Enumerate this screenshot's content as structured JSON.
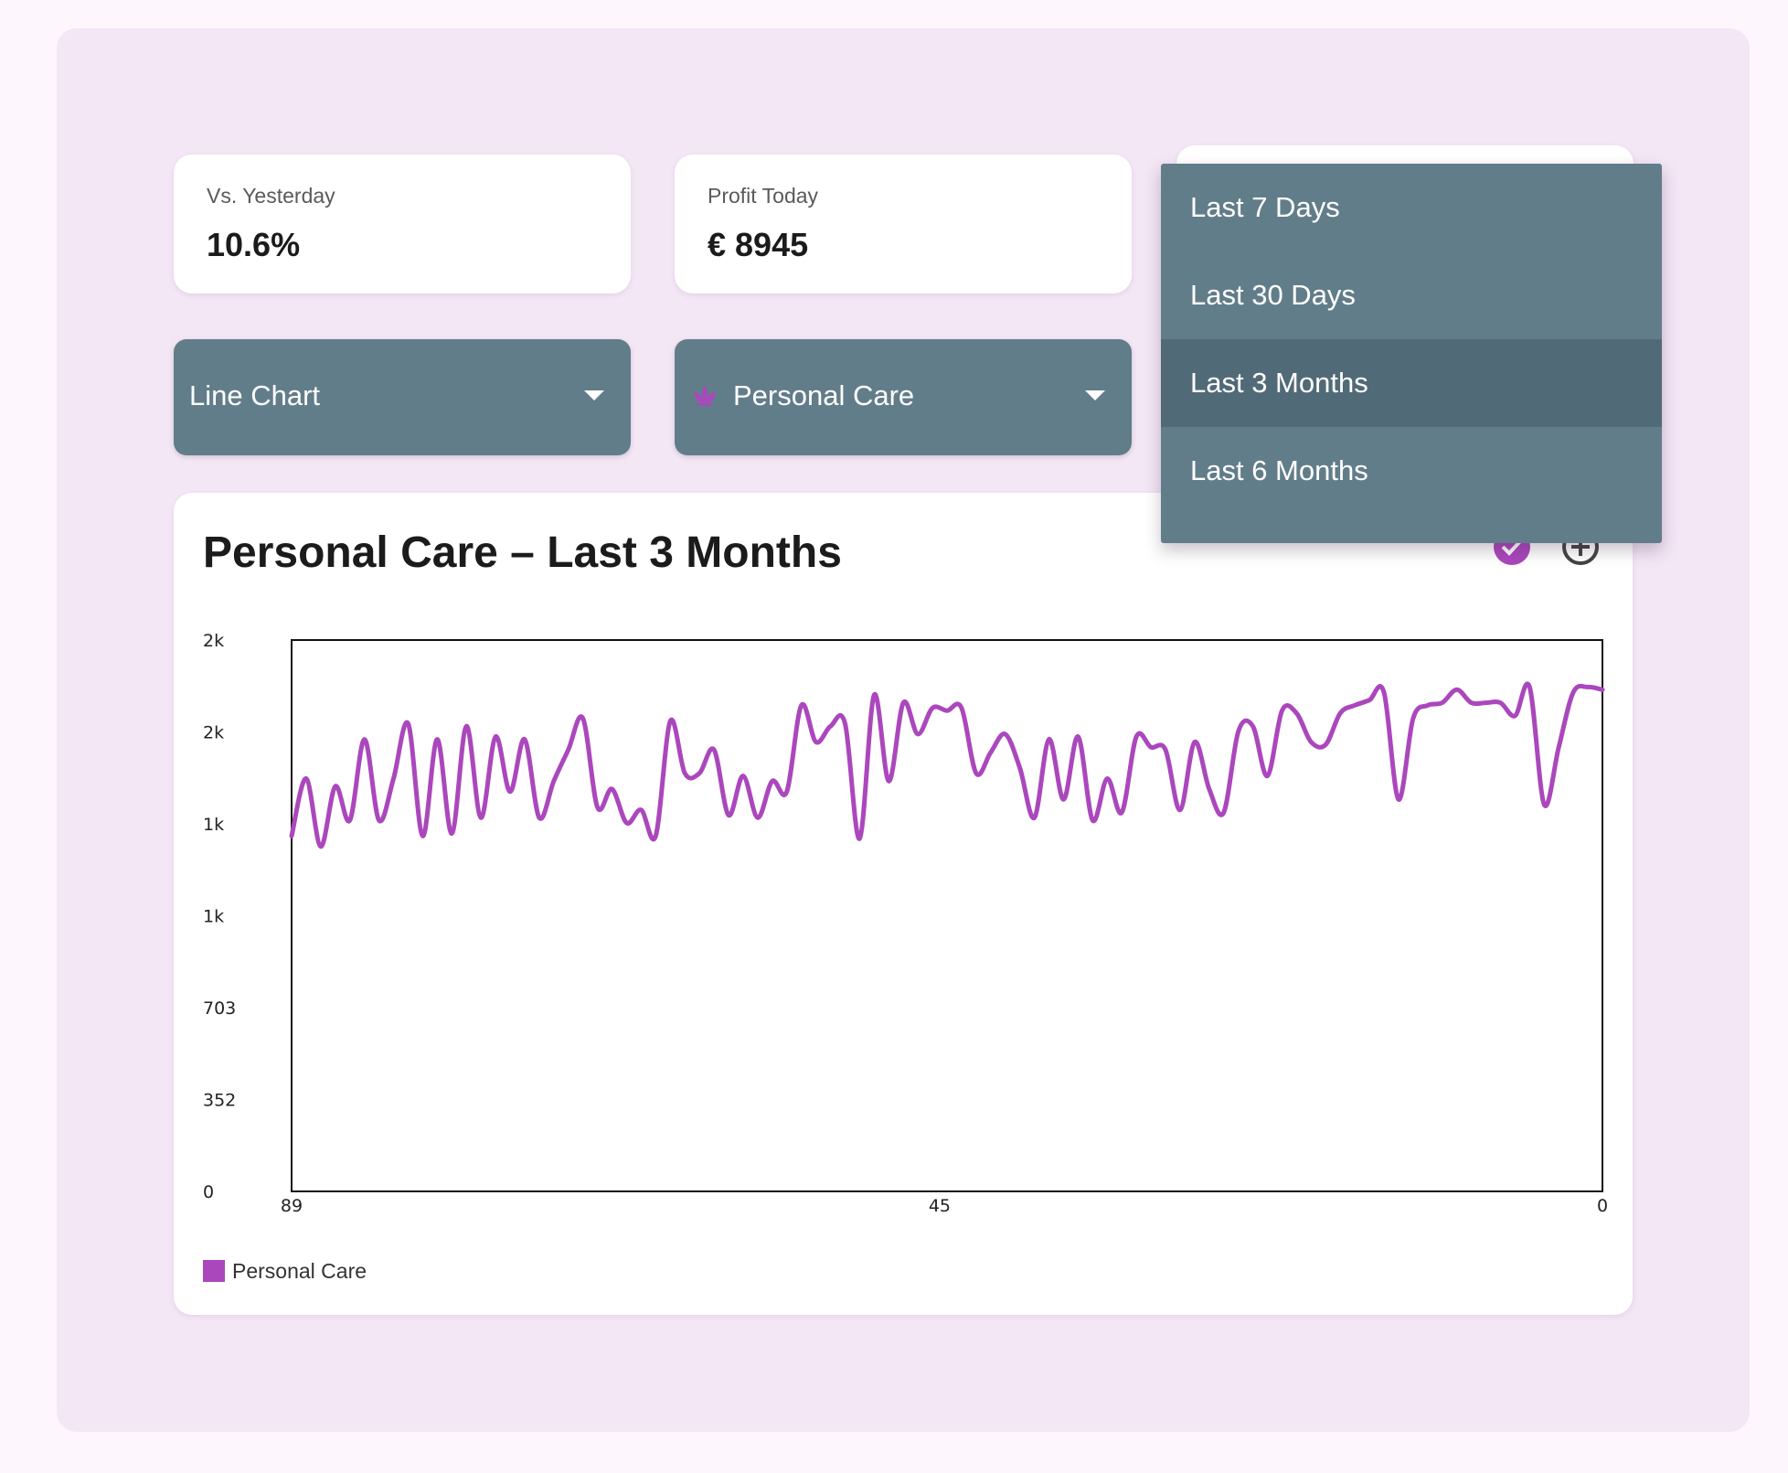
{
  "stats": [
    {
      "label": "Vs. Yesterday",
      "value": "10.6%"
    },
    {
      "label": "Profit Today",
      "value": "€ 8945"
    }
  ],
  "chart_type_select": {
    "value": "Line Chart"
  },
  "category_select": {
    "value": "Personal Care",
    "icon": "lotus-icon",
    "icon_color": "#ab47bc"
  },
  "period_menu": {
    "options": [
      "Last 7 Days",
      "Last 30 Days",
      "Last 3 Months",
      "Last 6 Months"
    ],
    "selected": "Last 3 Months"
  },
  "chart_card": {
    "title": "Personal Care – Last 3 Months",
    "actions": [
      "check-circle-icon",
      "add-circle-icon"
    ]
  },
  "colors": {
    "accent": "#ab47bc",
    "select_bg": "#627d8a",
    "menu_selected": "#516a77",
    "panel": "#f3e6f5"
  },
  "chart_data": {
    "type": "line",
    "title": "Personal Care – Last 3 Months",
    "xlabel": "",
    "ylabel": "",
    "x_reversed": true,
    "xlim": [
      89,
      0
    ],
    "ylim": [
      0,
      2110
    ],
    "y_tick_labels": [
      "0",
      "352",
      "703",
      "1k",
      "1k",
      "2k",
      "2k"
    ],
    "x_tick_labels": [
      "89",
      "45",
      "0"
    ],
    "legend_position": "bottom-left",
    "grid": false,
    "series": [
      {
        "name": "Personal Care",
        "color": "#ab47bc",
        "x": [
          89,
          88,
          87,
          86,
          85,
          84,
          83,
          82,
          81,
          80,
          79,
          78,
          77,
          76,
          75,
          74,
          73,
          72,
          71,
          70,
          69,
          68,
          67,
          66,
          65,
          64,
          63,
          62,
          61,
          60,
          59,
          58,
          57,
          56,
          55,
          54,
          53,
          52,
          51,
          50,
          49,
          48,
          47,
          46,
          45,
          44,
          43,
          42,
          41,
          40,
          39,
          38,
          37,
          36,
          35,
          34,
          33,
          32,
          31,
          30,
          29,
          28,
          27,
          26,
          25,
          24,
          23,
          22,
          21,
          20,
          19,
          18,
          17,
          16,
          15,
          14,
          13,
          14,
          12,
          11,
          10,
          9,
          8,
          7,
          6,
          5,
          4,
          3,
          2,
          1,
          0
        ],
        "values": [
          1360,
          1580,
          1320,
          1550,
          1420,
          1730,
          1420,
          1580,
          1790,
          1360,
          1730,
          1370,
          1780,
          1430,
          1740,
          1530,
          1730,
          1430,
          1570,
          1690,
          1810,
          1470,
          1540,
          1410,
          1460,
          1360,
          1800,
          1600,
          1600,
          1690,
          1440,
          1590,
          1430,
          1570,
          1530,
          1860,
          1720,
          1780,
          1790,
          1350,
          1900,
          1570,
          1870,
          1750,
          1850,
          1840,
          1850,
          1600,
          1680,
          1750,
          1620,
          1430,
          1730,
          1500,
          1740,
          1420,
          1580,
          1450,
          1740,
          1700,
          1690,
          1460,
          1720,
          1540,
          1450,
          1760,
          1780,
          1590,
          1840,
          1830,
          1720,
          1710,
          1830,
          1860,
          1880,
          1910,
          1500,
          1810,
          1860,
          1870,
          1920,
          1870,
          1870,
          1870,
          1820,
          1930,
          1480,
          1700,
          1910,
          1930,
          1920
        ]
      }
    ]
  }
}
